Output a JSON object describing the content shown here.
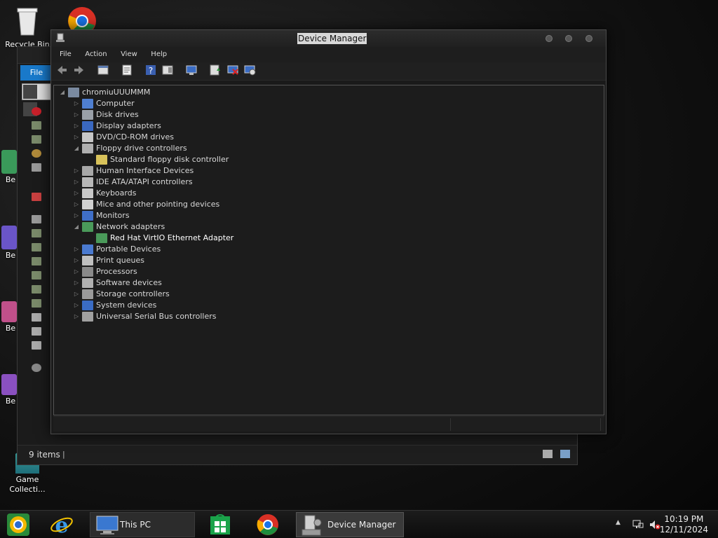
{
  "desktop": {
    "icons": [
      {
        "label": "Recycle Bin",
        "icon": "recycle-bin-icon"
      },
      {
        "label": "",
        "icon": "chrome-icon"
      },
      {
        "label": "Be",
        "icon": "app-icon"
      },
      {
        "label": "Be",
        "icon": "app-icon"
      },
      {
        "label": "Be",
        "icon": "app-icon"
      },
      {
        "label": "Be",
        "icon": "app-icon"
      },
      {
        "label": "Game Collecti...",
        "icon": "game-collection-icon"
      }
    ]
  },
  "explorer": {
    "file_tab": "File",
    "status": {
      "item_count": "9 items"
    }
  },
  "device_manager": {
    "title": "Device Manager",
    "menu": [
      "File",
      "Action",
      "View",
      "Help"
    ],
    "toolbar": [
      "back-arrow-icon",
      "forward-arrow-icon",
      "show-hide-console-tree-icon",
      "properties-icon",
      "help-icon",
      "action-pane-icon",
      "scan-hardware-icon",
      "update-driver-icon",
      "uninstall-device-icon",
      "enable-device-icon"
    ],
    "tree": {
      "root": "chromiuUUUMMM",
      "categories": [
        {
          "label": "Computer",
          "expanded": false,
          "color": "#4f7fd0",
          "icon": "computer-icon"
        },
        {
          "label": "Disk drives",
          "expanded": false,
          "color": "#9aa0a8",
          "icon": "disk-drive-icon"
        },
        {
          "label": "Display adapters",
          "expanded": false,
          "color": "#3a68c0",
          "icon": "display-adapter-icon"
        },
        {
          "label": "DVD/CD-ROM drives",
          "expanded": false,
          "color": "#c7c7c7",
          "icon": "dvd-drive-icon"
        },
        {
          "label": "Floppy drive controllers",
          "expanded": true,
          "color": "#b0b0b0",
          "icon": "floppy-controller-icon",
          "children": [
            {
              "label": "Standard floppy disk controller",
              "color": "#d8c25a",
              "icon": "floppy-disk-controller-icon"
            }
          ]
        },
        {
          "label": "Human Interface Devices",
          "expanded": false,
          "color": "#a8a8a8",
          "icon": "hid-icon"
        },
        {
          "label": "IDE ATA/ATAPI controllers",
          "expanded": false,
          "color": "#b8b8b8",
          "icon": "ide-controller-icon"
        },
        {
          "label": "Keyboards",
          "expanded": false,
          "color": "#c8c8c8",
          "icon": "keyboard-icon"
        },
        {
          "label": "Mice and other pointing devices",
          "expanded": false,
          "color": "#d0d0d0",
          "icon": "mouse-icon"
        },
        {
          "label": "Monitors",
          "expanded": false,
          "color": "#3f6fc8",
          "icon": "monitor-icon"
        },
        {
          "label": "Network adapters",
          "expanded": true,
          "color": "#4a9a5a",
          "icon": "network-adapter-icon",
          "children": [
            {
              "label": "Red Hat VirtIO Ethernet Adapter",
              "color": "#4a9a5a",
              "icon": "ethernet-adapter-icon"
            }
          ]
        },
        {
          "label": "Portable Devices",
          "expanded": false,
          "color": "#4a7ad0",
          "icon": "portable-device-icon"
        },
        {
          "label": "Print queues",
          "expanded": false,
          "color": "#c0c0c0",
          "icon": "printer-icon"
        },
        {
          "label": "Processors",
          "expanded": false,
          "color": "#8a8a8a",
          "icon": "processor-icon"
        },
        {
          "label": "Software devices",
          "expanded": false,
          "color": "#b0b0b0",
          "icon": "software-device-icon"
        },
        {
          "label": "Storage controllers",
          "expanded": false,
          "color": "#9a9a9a",
          "icon": "storage-controller-icon"
        },
        {
          "label": "System devices",
          "expanded": false,
          "color": "#3a6cc4",
          "icon": "system-device-icon"
        },
        {
          "label": "Universal Serial Bus controllers",
          "expanded": false,
          "color": "#a0a0a0",
          "icon": "usb-icon"
        }
      ]
    }
  },
  "taskbar": {
    "items": [
      {
        "label": "",
        "icon": "chrome-canary-icon"
      },
      {
        "label": "",
        "icon": "internet-explorer-icon"
      },
      {
        "label": "This PC",
        "icon": "this-pc-icon"
      },
      {
        "label": "",
        "icon": "store-icon"
      },
      {
        "label": "",
        "icon": "chrome-icon"
      },
      {
        "label": "Device Manager",
        "icon": "device-manager-icon",
        "active": true
      }
    ],
    "tray": {
      "time": "10:19 PM",
      "date": "12/11/2024",
      "icons": [
        "show-hidden-icons-chevron",
        "network-icon",
        "volume-muted-icon"
      ]
    }
  }
}
